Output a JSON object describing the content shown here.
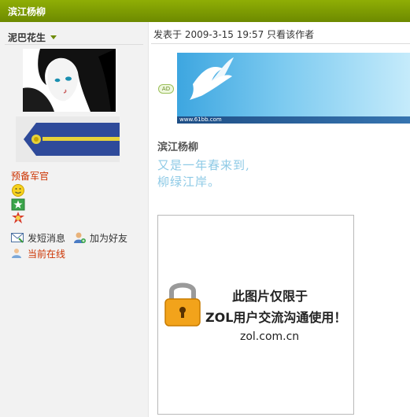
{
  "header": {
    "title": "滨江杨柳"
  },
  "user": {
    "name": "泥巴花生",
    "rank_title": "预备军官",
    "medals": [
      "smiley-medal-icon",
      "star-medal-icon",
      "badge-medal-icon"
    ],
    "actions": {
      "message": "发短消息",
      "add_friend": "加为好友",
      "online": "当前在线"
    }
  },
  "post": {
    "meta": "发表于  2009-3-15 19:57  只看该作者",
    "ad": {
      "tag": "AD",
      "url": "www.61bb.com"
    },
    "title": "滨江杨柳",
    "lines": [
      "又是一年春来到,",
      "柳绿江岸。"
    ],
    "image_notice": {
      "line1": "此图片仅限于",
      "line2": "ZOL用户交流沟通使用！",
      "line3": "zol.com.cn"
    }
  },
  "colors": {
    "header_green": "#7b9a00",
    "rank_red": "#cc3300",
    "poem_blue": "#8ecae6"
  }
}
